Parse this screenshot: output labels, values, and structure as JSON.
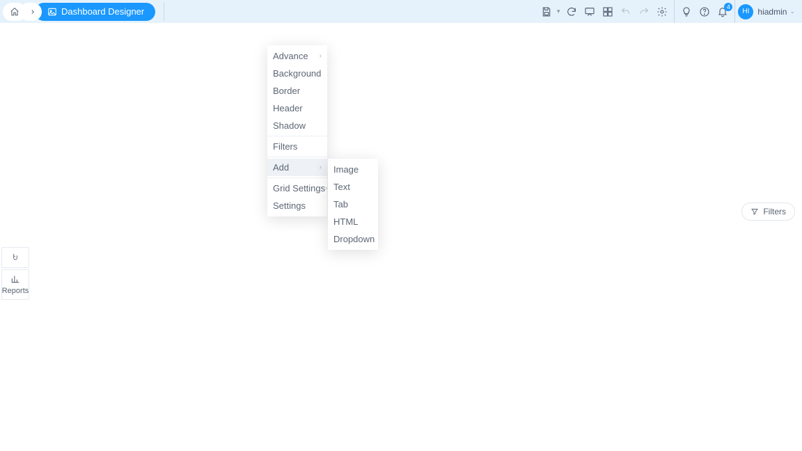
{
  "breadcrumb": {
    "title": "Dashboard Designer"
  },
  "toolbar": {
    "notification_count": "4"
  },
  "user": {
    "initials": "HI",
    "name": "hiadmin"
  },
  "filters_button": "Filters",
  "side": {
    "reports": "Reports"
  },
  "context_menu": {
    "items": [
      "Advance",
      "Background",
      "Border",
      "Header",
      "Shadow",
      "Filters",
      "Add",
      "Grid Settings",
      "Settings"
    ],
    "add_submenu": [
      "Image",
      "Text",
      "Tab",
      "HTML",
      "Dropdown"
    ]
  }
}
